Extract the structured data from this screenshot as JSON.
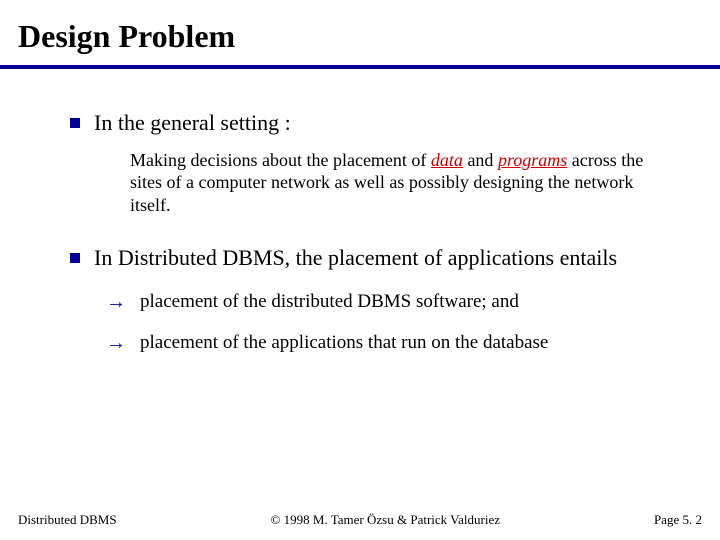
{
  "title": "Design Problem",
  "bullets": [
    {
      "text": "In the general setting :",
      "sub_pre": "Making decisions about the placement of ",
      "em1": "data",
      "mid": " and ",
      "em2": "programs",
      "sub_post": " across the sites of a computer network as well as possibly designing the network itself."
    },
    {
      "text": "In Distributed DBMS, the placement of applications entails",
      "arrows": [
        "placement of the distributed DBMS software; and",
        "placement of the applications that run on the database"
      ]
    }
  ],
  "footer": {
    "left": "Distributed DBMS",
    "center": "© 1998 M. Tamer Özsu & Patrick Valduriez",
    "right": "Page 5. 2"
  }
}
